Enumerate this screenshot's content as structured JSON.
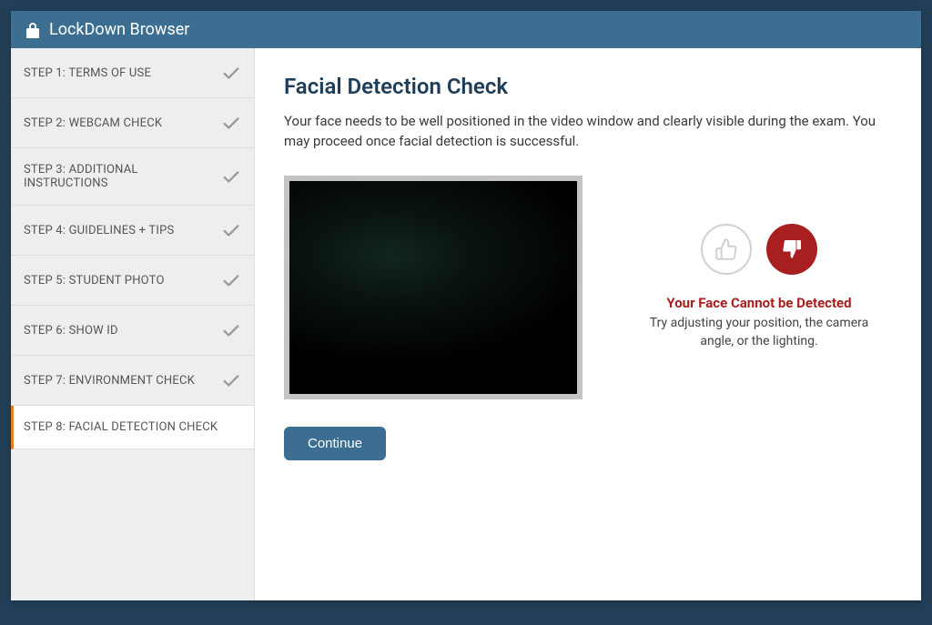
{
  "app": {
    "title": "LockDown Browser"
  },
  "sidebar": {
    "items": [
      {
        "label": "STEP 1: TERMS OF USE",
        "checked": true,
        "active": false
      },
      {
        "label": "STEP 2: WEBCAM CHECK",
        "checked": true,
        "active": false
      },
      {
        "label": "STEP 3: ADDITIONAL INSTRUCTIONS",
        "checked": true,
        "active": false
      },
      {
        "label": "STEP 4: GUIDELINES + TIPS",
        "checked": true,
        "active": false
      },
      {
        "label": "STEP 5: STUDENT PHOTO",
        "checked": true,
        "active": false
      },
      {
        "label": "STEP 6: SHOW ID",
        "checked": true,
        "active": false
      },
      {
        "label": "STEP 7: ENVIRONMENT CHECK",
        "checked": true,
        "active": false
      },
      {
        "label": "STEP 8: FACIAL DETECTION CHECK",
        "checked": false,
        "active": true
      }
    ]
  },
  "main": {
    "title": "Facial Detection Check",
    "description": "Your face needs to be well positioned in the video window and clearly visible during the exam. You may proceed once facial detection is successful.",
    "status": {
      "heading": "Your Face Cannot be Detected",
      "text": "Try adjusting your position, the camera angle, or the lighting."
    },
    "continue_label": "Continue"
  }
}
